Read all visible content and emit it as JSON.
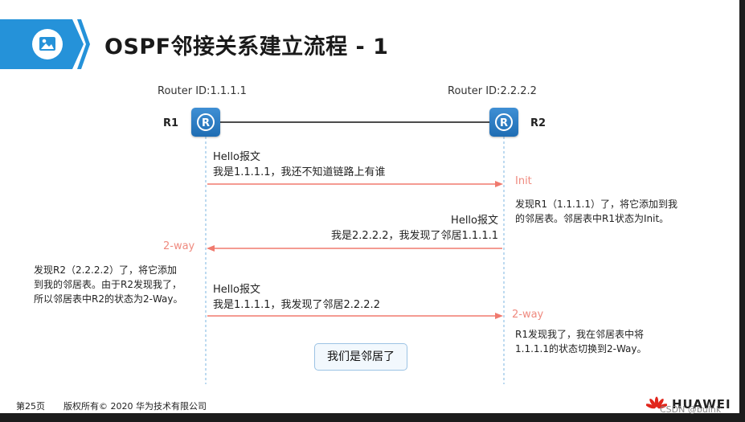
{
  "title": "OSPF邻接关系建立流程 - 1",
  "routers": {
    "r1": {
      "name": "R1",
      "id_label": "Router ID:1.1.1.1"
    },
    "r2": {
      "name": "R2",
      "id_label": "Router ID:2.2.2.2"
    }
  },
  "messages": [
    {
      "line1": "Hello报文",
      "line2": "我是1.1.1.1，我还不知道链路上有谁",
      "direction": "R1->R2"
    },
    {
      "line1": "Hello报文",
      "line2": "我是2.2.2.2，我发现了邻居1.1.1.1",
      "direction": "R2->R1"
    },
    {
      "line1": "Hello报文",
      "line2": "我是1.1.1.1，我发现了邻居2.2.2.2",
      "direction": "R1->R2"
    }
  ],
  "states": {
    "r2_init": "Init",
    "r1_2way": "2-way",
    "r2_2way": "2-way"
  },
  "notes": {
    "r2_note1": [
      "发现R1（1.1.1.1）了，将它添加到我",
      "的邻居表。邻居表中R1状态为Init。"
    ],
    "r1_note": [
      "发现R2（2.2.2.2）了，将它添加",
      "到我的邻居表。由于R2发现我了，",
      "所以邻居表中R2的状态为2-Way。"
    ],
    "r2_note2": [
      "R1发现我了，我在邻居表中将",
      "1.1.1.1的状态切换到2-Way。"
    ]
  },
  "neighbor_box": "我们是邻居了",
  "footer": {
    "page": "第25页",
    "copyright": "版权所有© 2020 华为技术有限公司",
    "brand": "HUAWEI",
    "watermark": "CSDN @bulnk"
  },
  "colors": {
    "arrow": "#f07a6e",
    "state": "#ef8a7f",
    "title_band": "#2592d9",
    "dashed_line": "#7bb6e2"
  },
  "icons": [
    "image-icon",
    "router-icon",
    "huawei-logo-icon"
  ]
}
